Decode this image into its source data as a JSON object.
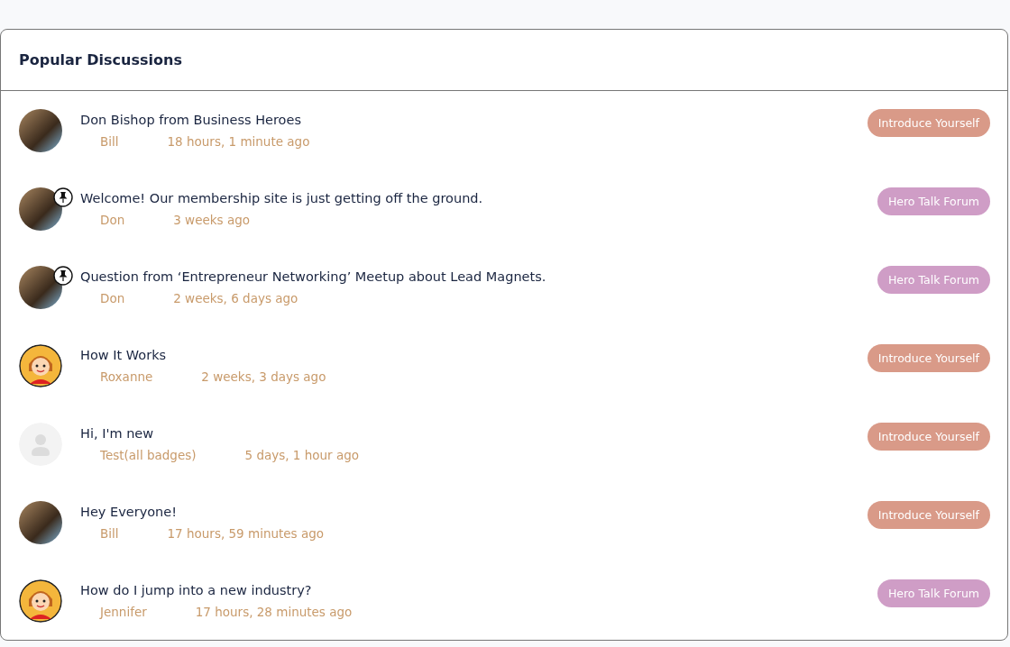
{
  "card": {
    "title": "Popular Discussions"
  },
  "discussions": [
    {
      "kind": "photo",
      "pinned": false,
      "title": "Don Bishop from Business Heroes",
      "author": "Bill",
      "time": "18 hours, 1 minute ago",
      "forum": "Introduce Yourself",
      "color": "#d99a88"
    },
    {
      "kind": "photo",
      "pinned": true,
      "title": "Welcome! Our membership site is just getting off the ground.",
      "author": "Don",
      "time": "3 weeks ago",
      "forum": "Hero Talk Forum",
      "color": "#cf9dc6"
    },
    {
      "kind": "photo",
      "pinned": true,
      "title": "Question from ‘Entrepreneur Networking’ Meetup about Lead Magnets.",
      "author": "Don",
      "time": "2 weeks, 6 days ago",
      "forum": "Hero Talk Forum",
      "color": "#cf9dc6"
    },
    {
      "kind": "cartoon",
      "pinned": false,
      "title": "How It Works",
      "author": "Roxanne",
      "time": "2 weeks, 3 days ago",
      "forum": "Introduce Yourself",
      "color": "#d99a88"
    },
    {
      "kind": "default",
      "pinned": false,
      "title": "Hi, I'm new",
      "author": "Test(all badges)",
      "time": "5 days, 1 hour ago",
      "forum": "Introduce Yourself",
      "color": "#d99a88"
    },
    {
      "kind": "photo",
      "pinned": false,
      "title": "Hey Everyone!",
      "author": "Bill",
      "time": "17 hours, 59 minutes ago",
      "forum": "Introduce Yourself",
      "color": "#d99a88"
    },
    {
      "kind": "cartoon",
      "pinned": false,
      "title": "How do I jump into a new industry?",
      "author": "Jennifer",
      "time": "17 hours, 28 minutes ago",
      "forum": "Hero Talk Forum",
      "color": "#cf9dc6"
    }
  ]
}
